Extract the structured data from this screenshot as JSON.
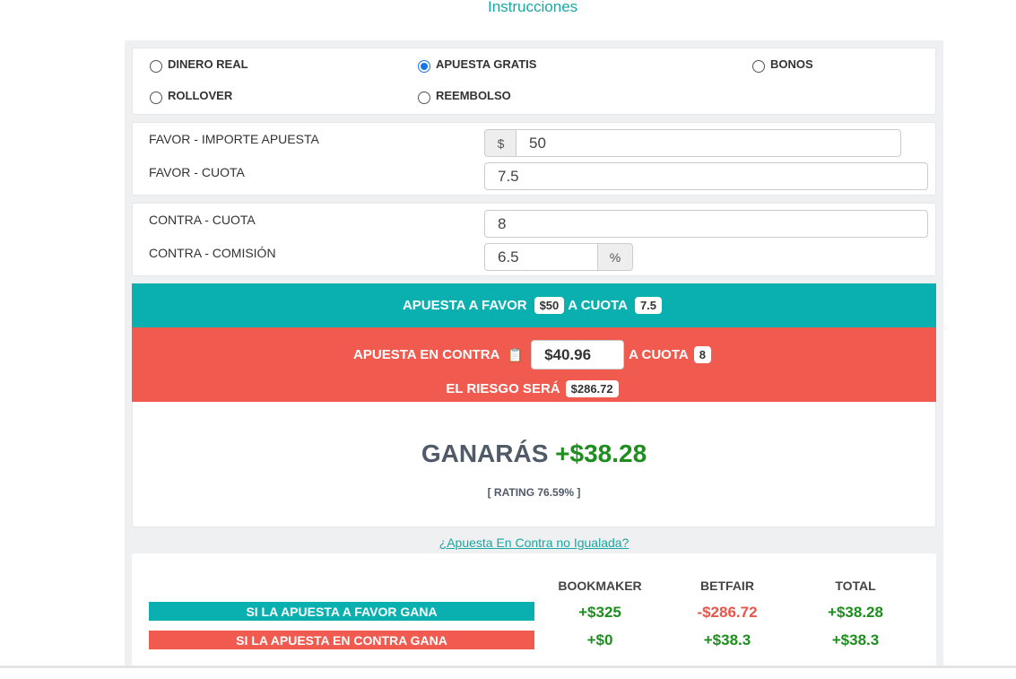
{
  "header": {
    "instructions_link": "Instrucciones"
  },
  "bet_types": {
    "options": [
      "DINERO REAL",
      "APUESTA GRATIS",
      "BONOS",
      "ROLLOVER",
      "REEMBOLSO"
    ],
    "selected": "APUESTA GRATIS"
  },
  "favor": {
    "stake_label": "FAVOR - IMPORTE APUESTA",
    "currency_symbol": "$",
    "stake_value": "50",
    "odds_label": "FAVOR - CUOTA",
    "odds_value": "7.5"
  },
  "contra": {
    "odds_label": "CONTRA - CUOTA",
    "odds_value": "8",
    "commission_label": "CONTRA - COMISIÓN",
    "commission_value": "6.5",
    "percent_symbol": "%"
  },
  "summary": {
    "back_text": "APUESTA A FAVOR",
    "back_stake": "$50",
    "odds_text": "A CUOTA",
    "back_odds": "7.5",
    "lay_text": "APUESTA EN CONTRA",
    "lay_stake": "$40.96",
    "lay_odds": "8",
    "risk_text": "EL RIESGO SERÁ",
    "risk_value": "$286.72"
  },
  "result": {
    "win_text": "GANARÁS",
    "win_amount": "+$38.28",
    "rating": "[ RATING 76.59% ]",
    "unmatched_link": "¿Apuesta En Contra no Igualada?"
  },
  "table": {
    "headers": [
      "BOOKMAKER",
      "BETFAIR",
      "TOTAL"
    ],
    "rows": [
      {
        "label": "SI LA APUESTA A FAVOR GANA",
        "values": [
          "+$325",
          "-$286.72",
          "+$38.28"
        ]
      },
      {
        "label": "SI LA APUESTA EN CONTRA GANA",
        "values": [
          "+$0",
          "+$38.3",
          "+$38.3"
        ]
      }
    ]
  },
  "colors": {
    "accent": "#0ab0b0",
    "lay": "#f05a4f",
    "positive": "#1e8e1e",
    "negative": "#e8554a",
    "link": "#1aa8a1"
  }
}
